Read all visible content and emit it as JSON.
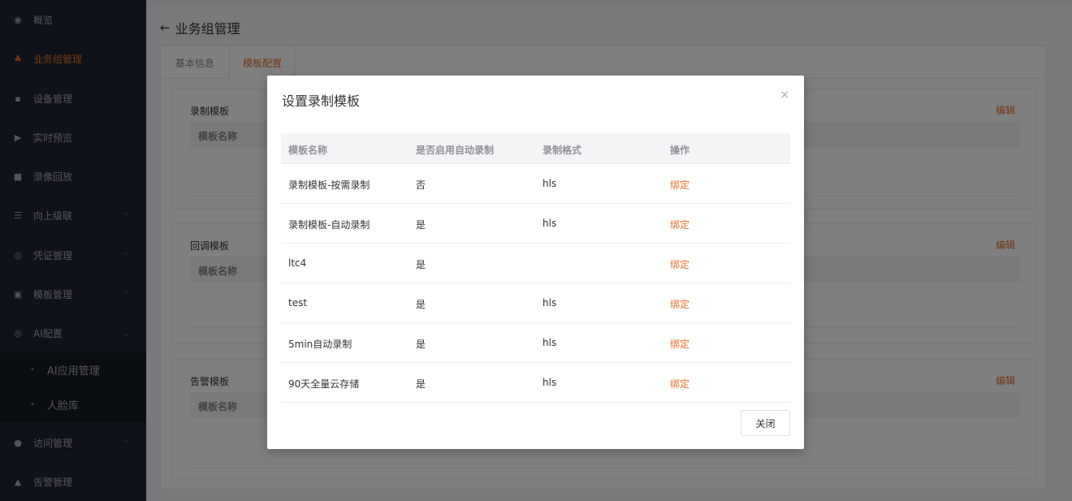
{
  "sidebar": {
    "items": [
      {
        "icon": "dashboard-icon",
        "glyph": "◉",
        "label": "概览"
      },
      {
        "icon": "org-icon",
        "glyph": "♣",
        "label": "业务组管理"
      },
      {
        "icon": "grid-icon",
        "glyph": "▪",
        "label": "设备管理"
      },
      {
        "icon": "preview-icon",
        "glyph": "▶",
        "label": "实时预览"
      },
      {
        "icon": "video-icon",
        "glyph": "■",
        "label": "录像回放"
      },
      {
        "icon": "cascade-icon",
        "glyph": "☰",
        "label": "向上级联"
      },
      {
        "icon": "credential-icon",
        "glyph": "◎",
        "label": "凭证管理"
      },
      {
        "icon": "template-icon",
        "glyph": "▣",
        "label": "模板管理"
      },
      {
        "icon": "ai-icon",
        "glyph": "◎",
        "label": "AI配置"
      },
      {
        "icon": "user-icon",
        "glyph": "●",
        "label": "访问管理"
      },
      {
        "icon": "alarm-icon",
        "glyph": "▲",
        "label": "告警管理"
      }
    ],
    "sub_items": [
      {
        "label": "AI应用管理"
      },
      {
        "label": "人脸库"
      }
    ]
  },
  "header": {
    "back_arrow": "←",
    "title": "业务组管理"
  },
  "tabs": [
    {
      "label": "基本信息"
    },
    {
      "label": "模板配置"
    }
  ],
  "sections": [
    {
      "title": "录制模板",
      "edit": "编辑",
      "column": "模板名称"
    },
    {
      "title": "回调模板",
      "edit": "编辑",
      "column": "模板名称"
    },
    {
      "title": "告警模板",
      "edit": "编辑",
      "column": "模板名称"
    }
  ],
  "modal": {
    "title": "设置录制模板",
    "close_icon": "×",
    "columns": [
      "模板名称",
      "是否启用自动录制",
      "录制格式",
      "操作"
    ],
    "rows": [
      {
        "name": "录制模板-按需录制",
        "auto": "否",
        "format": "hls",
        "action": "绑定"
      },
      {
        "name": "录制模板-自动录制",
        "auto": "是",
        "format": "hls",
        "action": "绑定"
      },
      {
        "name": "ltc4",
        "auto": "是",
        "format": "",
        "action": "绑定"
      },
      {
        "name": "test",
        "auto": "是",
        "format": "hls",
        "action": "绑定"
      },
      {
        "name": "5min自动录制",
        "auto": "是",
        "format": "hls",
        "action": "绑定"
      },
      {
        "name": "90天全量云存储",
        "auto": "是",
        "format": "hls",
        "action": "绑定"
      }
    ],
    "close_button": "关闭"
  },
  "colors": {
    "accent": "#e8702a",
    "sidebar_bg": "#1f2530"
  }
}
